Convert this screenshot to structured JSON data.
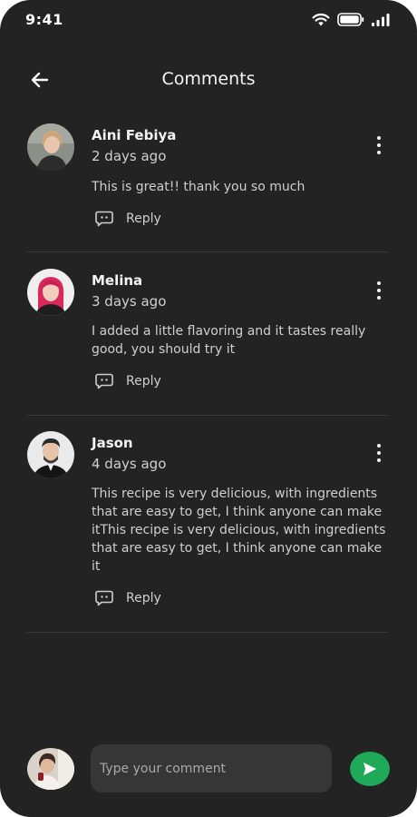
{
  "status_bar": {
    "time": "9:41"
  },
  "header": {
    "title": "Comments"
  },
  "comments": [
    {
      "name": "Aini Febiya",
      "time": "2 days ago",
      "text": "This is great!! thank you so much",
      "reply_label": "Reply"
    },
    {
      "name": "Melina",
      "time": "3 days ago",
      "text": "I added a little flavoring and it tastes really good, you should try it",
      "reply_label": "Reply"
    },
    {
      "name": "Jason",
      "time": "4 days ago",
      "text": "This recipe is very delicious, with ingredients that are easy to get, I think anyone can make itThis recipe is very delicious, with ingredients that are easy to get, I think anyone can make it",
      "reply_label": "Reply"
    }
  ],
  "composer": {
    "placeholder": "Type your comment"
  },
  "icons": {
    "back": "arrow-left-icon",
    "more": "more-vertical-icon",
    "reply": "chat-bubble-icon",
    "send": "send-icon",
    "wifi": "wifi-icon",
    "battery": "battery-icon",
    "signal": "signal-icon"
  },
  "colors": {
    "background": "#232323",
    "accent": "#1faa59",
    "input_bg": "#363636",
    "divider": "#3a3a3a"
  }
}
